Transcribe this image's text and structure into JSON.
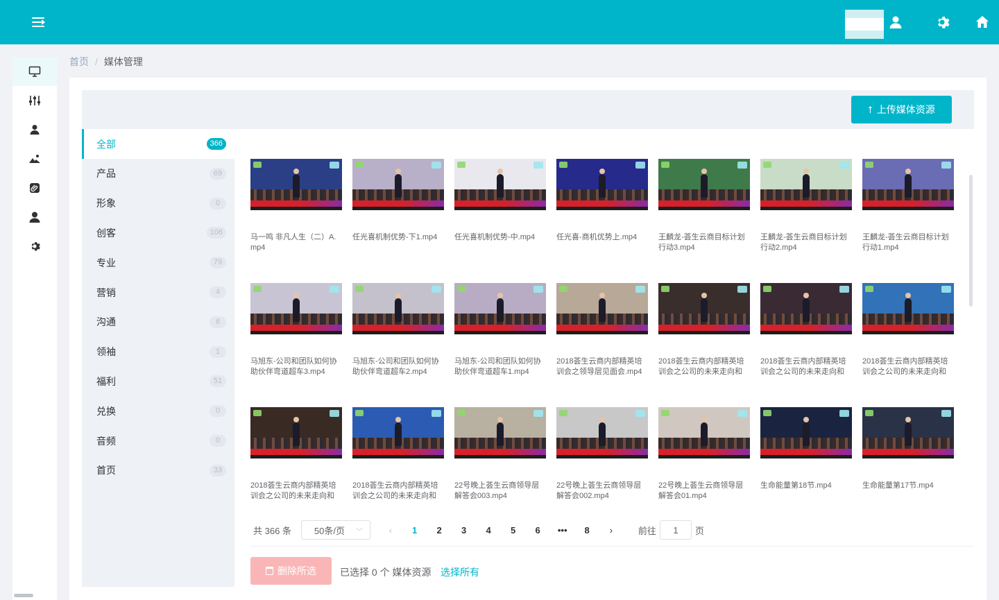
{
  "breadcrumb": {
    "home": "首页",
    "separator": "/",
    "current": "媒体管理"
  },
  "toolbar": {
    "upload_label": "上传媒体资源"
  },
  "categories": [
    {
      "name": "全部",
      "count": "366",
      "active": true
    },
    {
      "name": "产品",
      "count": "69"
    },
    {
      "name": "形象",
      "count": "0"
    },
    {
      "name": "创客",
      "count": "106"
    },
    {
      "name": "专业",
      "count": "79"
    },
    {
      "name": "营销",
      "count": "4"
    },
    {
      "name": "沟通",
      "count": "6"
    },
    {
      "name": "领袖",
      "count": "1"
    },
    {
      "name": "福利",
      "count": "51"
    },
    {
      "name": "兑换",
      "count": "0"
    },
    {
      "name": "音频",
      "count": "0"
    },
    {
      "name": "首页",
      "count": "33"
    }
  ],
  "media": [
    {
      "title": "马一鸣 非凡人生（二）A.mp4"
    },
    {
      "title": "任光喜机制优势-下1.mp4"
    },
    {
      "title": "任光喜机制优势-中.mp4"
    },
    {
      "title": "任光喜-商机优势上.mp4"
    },
    {
      "title": "王麟龙-荟生云商目标计划行动3.mp4"
    },
    {
      "title": "王麟龙-荟生云商目标计划行动2.mp4"
    },
    {
      "title": "王麟龙-荟生云商目标计划行动1.mp4"
    },
    {
      "title": "马旭东-公司和团队如何协助伙伴弯道超车3.mp4"
    },
    {
      "title": "马旭东-公司和团队如何协助伙伴弯道超车2.mp4"
    },
    {
      "title": "马旭东-公司和团队如何协助伙伴弯道超车1.mp4"
    },
    {
      "title": "2018荟生云商内部精英培训会之领导层见面会.mp4"
    },
    {
      "title": "2018荟生云商内部精英培训会之公司的未来走向和"
    },
    {
      "title": "2018荟生云商内部精英培训会之公司的未来走向和"
    },
    {
      "title": "2018荟生云商内部精英培训会之公司的未来走向和"
    },
    {
      "title": "2018荟生云商内部精英培训会之公司的未来走向和"
    },
    {
      "title": "2018荟生云商内部精英培训会之公司的未来走向和"
    },
    {
      "title": "22号晚上荟生云商领导层解答会003.mp4"
    },
    {
      "title": "22号晚上荟生云商领导层解答会002.mp4"
    },
    {
      "title": "22号晚上荟生云商领导层解答会01.mp4"
    },
    {
      "title": "生命能量第18节.mp4"
    },
    {
      "title": "生命能量第17节.mp4"
    }
  ],
  "thumb_colors": [
    "#2a3f86",
    "#b8b0c8",
    "#e8e8ee",
    "#262a8a",
    "#3f7a4a",
    "#c8dcc8",
    "#6a6cb4",
    "#c9c4d4",
    "#c4c0cc",
    "#b8acc4",
    "#b8a898",
    "#3a2e2c",
    "#3a2a34",
    "#3272b8",
    "#3a2a24",
    "#2c5bb4",
    "#b8b0a0",
    "#c8c8c8",
    "#d0c8c0",
    "#1a2440",
    "#2a3248"
  ],
  "pagination": {
    "total": "共 366 条",
    "page_size": "50条/页",
    "pages": [
      "1",
      "2",
      "3",
      "4",
      "5",
      "6",
      "•••",
      "8"
    ],
    "current": "1",
    "goto_prefix": "前往",
    "goto_value": "1",
    "goto_suffix": "页"
  },
  "actions": {
    "delete_label": "删除所选",
    "selected_info": "已选择 0 个 媒体资源",
    "select_all": "选择所有"
  },
  "colors": {
    "brand": "#00b5c9",
    "danger_disabled": "#fab6b6"
  }
}
